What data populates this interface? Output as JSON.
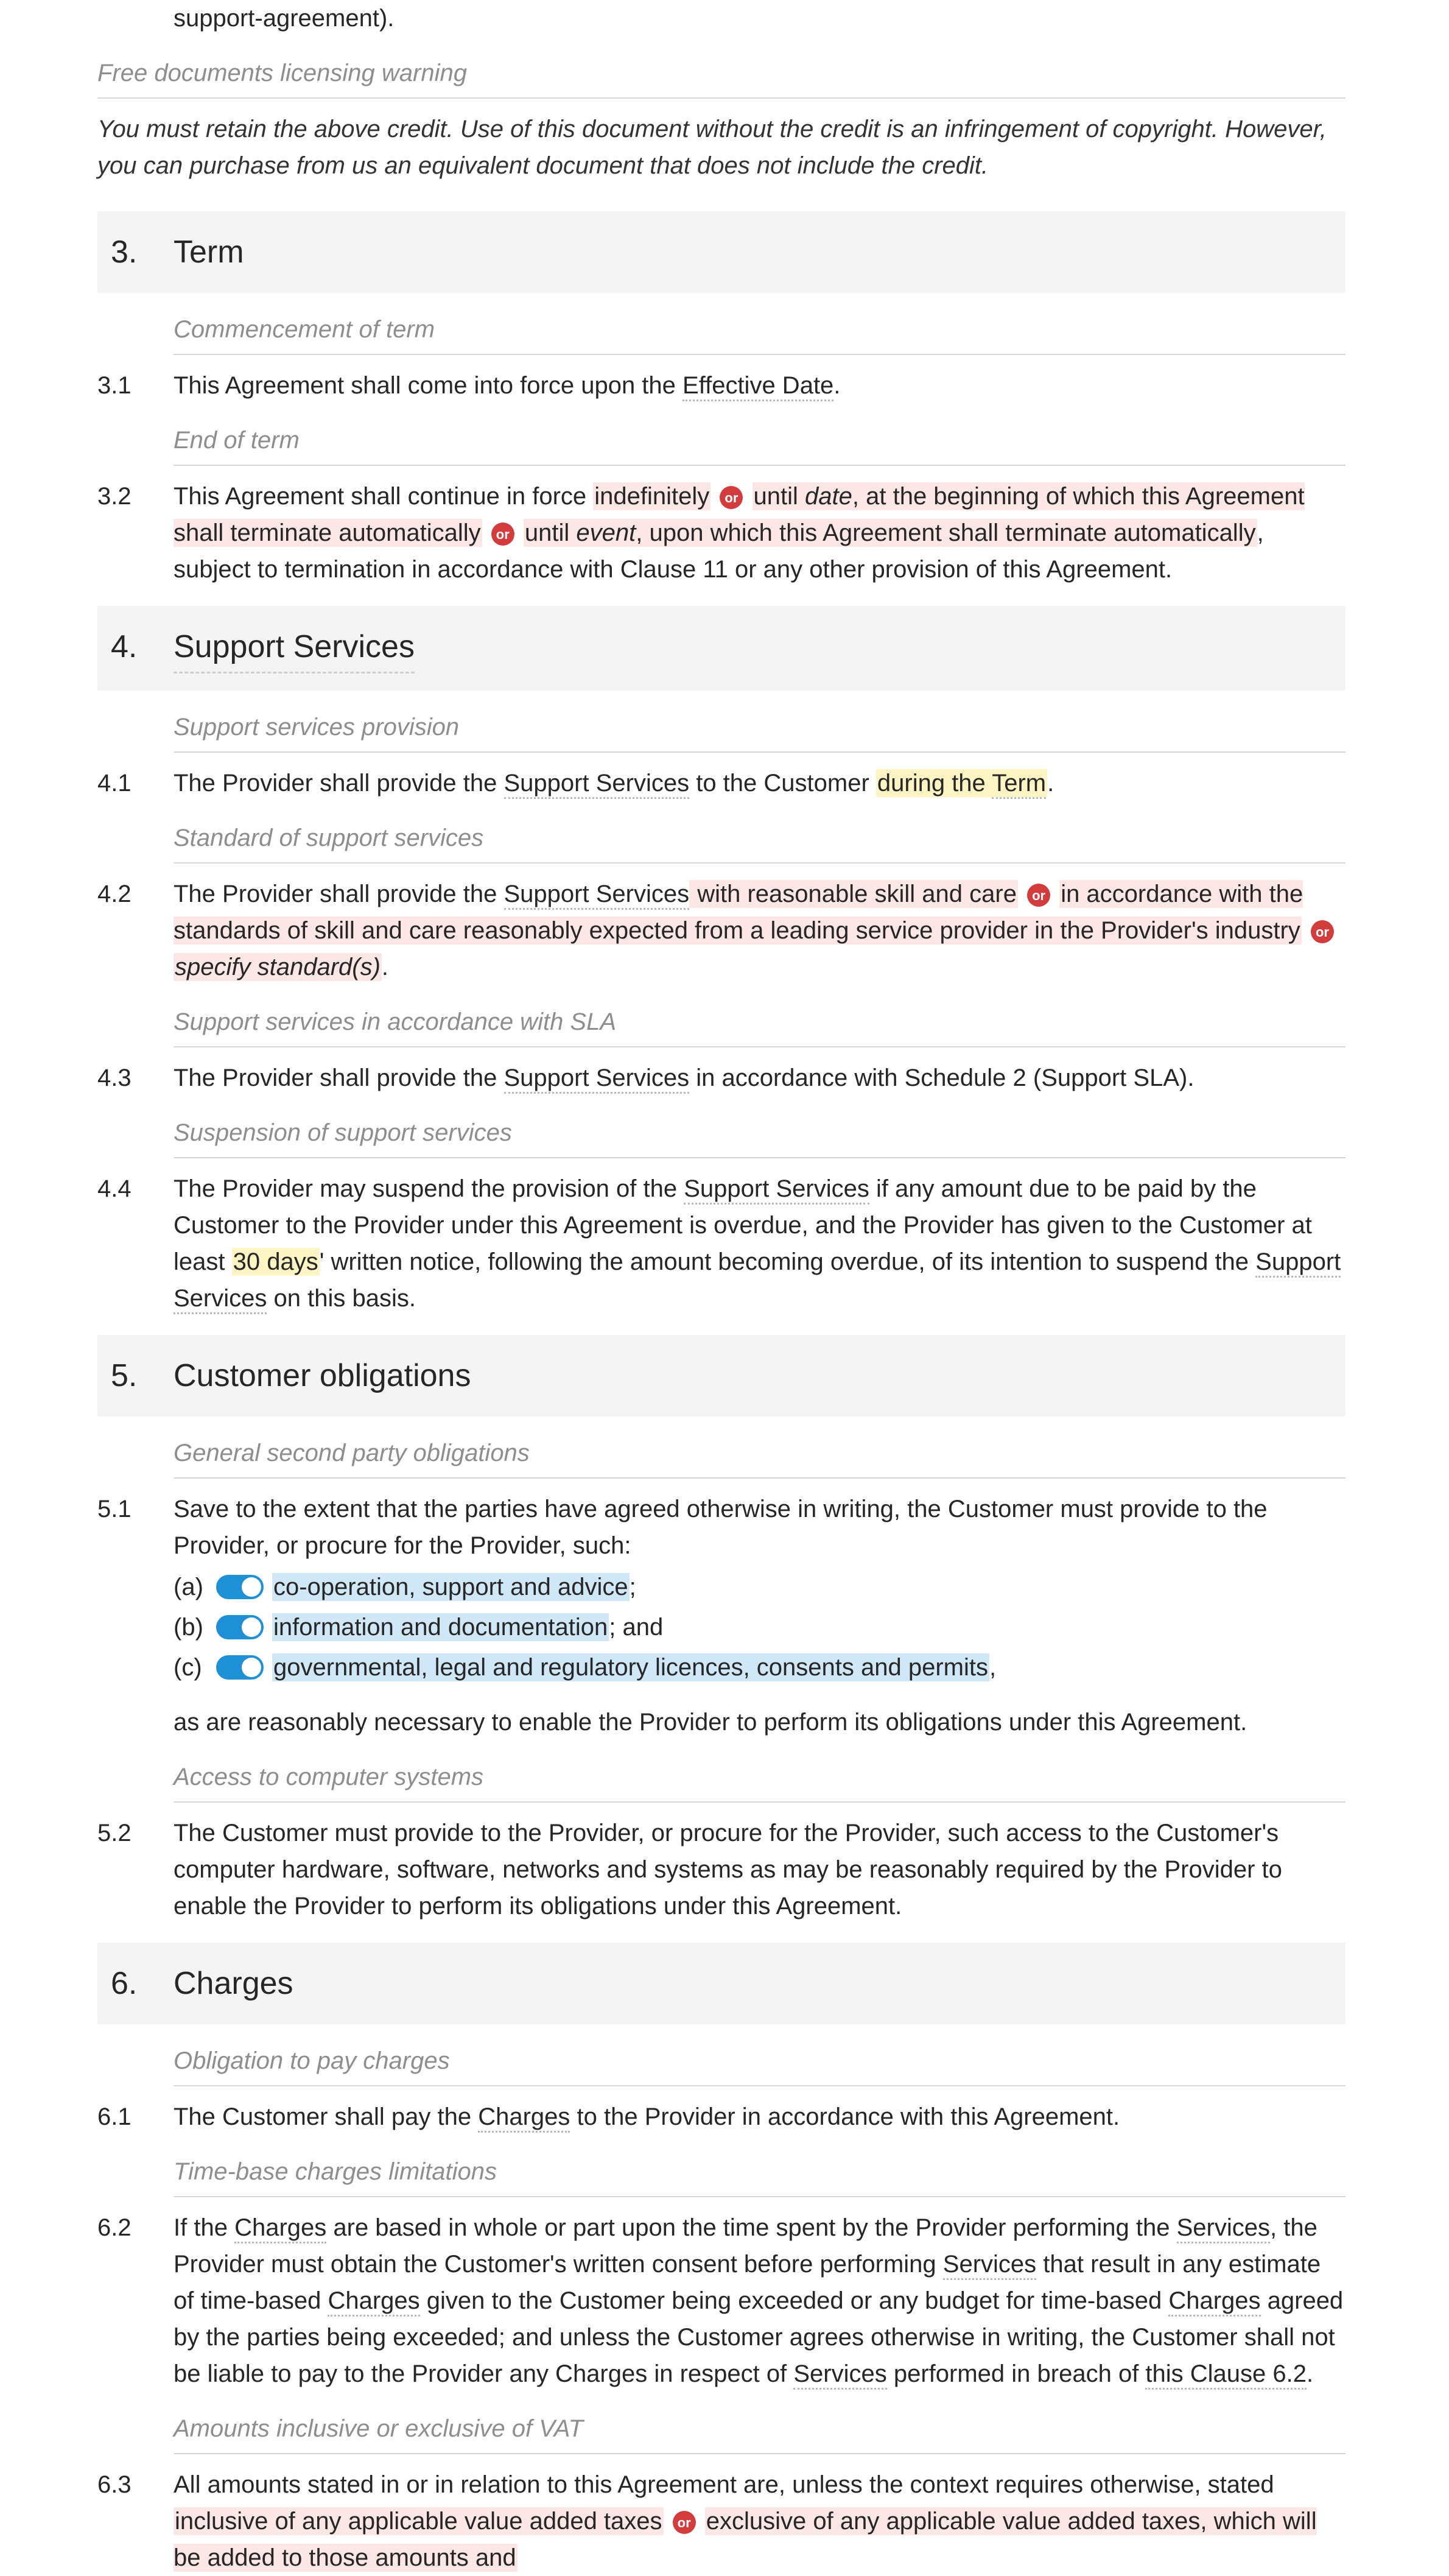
{
  "partial_top_line": "support-agreement).",
  "licensing_warning_label": "Free documents licensing warning",
  "licensing_warning_text": "You must retain the above credit. Use of this document without the credit is an infringement of copyright. However, you can purchase from us an equivalent document that does not include the credit.",
  "or_label": "or",
  "sections": {
    "s3": {
      "number": "3.",
      "title": "Term",
      "clauses": {
        "c1": {
          "annotation": "Commencement of term",
          "number": "3.1",
          "pre": "This Agreement shall come into force upon the ",
          "defined": "Effective Date",
          "post": "."
        },
        "c2": {
          "annotation": "End of term",
          "number": "3.2",
          "seg1": "This Agreement shall continue in force ",
          "opt1": "indefinitely",
          "opt2a": " until ",
          "opt2b": "date",
          "opt2c": ", at the beginning of which this Agreement shall terminate automatically",
          "opt3a": " until ",
          "opt3b": "event",
          "opt3c": ", upon which this Agreement shall terminate automatically",
          "seg2": ", subject to termination in accordance with Clause 11 or any other provision of this Agreement."
        }
      }
    },
    "s4": {
      "number": "4.",
      "title": "Support Services",
      "clauses": {
        "c1": {
          "annotation": "Support services provision",
          "number": "4.1",
          "a": "The Provider shall provide the ",
          "def1": "Support Services",
          "b": " to the Customer ",
          "hl": "during the ",
          "def2": "Term",
          "c": "."
        },
        "c2": {
          "annotation": "Standard of support services",
          "number": "4.2",
          "a": "The Provider shall provide the ",
          "def1": "Support Services",
          "opt1": " with reasonable skill and care",
          "opt2": " in accordance with the standards of skill and care reasonably expected from a leading service provider in the Provider's industry",
          "opt3": "specify standard(s)",
          "c": "."
        },
        "c3": {
          "annotation": "Support services in accordance with SLA",
          "number": "4.3",
          "a": "The Provider shall provide the ",
          "def1": "Support Services",
          "b": " in accordance with Schedule 2 (Support SLA)."
        },
        "c4": {
          "annotation": "Suspension of support services",
          "number": "4.4",
          "a": "The Provider may suspend the provision of the ",
          "def1": "Support Services",
          "b": " if any amount due to be paid by the Customer to the Provider under this Agreement is overdue, and the Provider has given to the Customer at least ",
          "hl": "30 days",
          "c": "' written notice, following the amount becoming overdue, of its intention to suspend the ",
          "def2": "Support Services",
          "d": " on this basis."
        }
      }
    },
    "s5": {
      "number": "5.",
      "title": "Customer obligations",
      "clauses": {
        "c1": {
          "annotation": "General second party obligations",
          "number": "5.1",
          "intro": "Save to the extent that the parties have agreed otherwise in writing, the Customer must provide to the Provider, or procure for the Provider, such:",
          "items": [
            {
              "letter": "(a)",
              "text": "co-operation, support and advice",
              "tail": ";"
            },
            {
              "letter": "(b)",
              "text": "information and documentation",
              "tail": "; and"
            },
            {
              "letter": "(c)",
              "text": "governmental, legal and regulatory licences, consents and permits",
              "tail": ","
            }
          ],
          "outro": "as are reasonably necessary to enable the Provider to perform its obligations under this Agreement."
        },
        "c2": {
          "annotation": "Access to computer systems",
          "number": "5.2",
          "text": "The Customer must provide to the Provider, or procure for the Provider, such access to the Customer's computer hardware, software, networks and systems as may be reasonably required by the Provider to enable the Provider to perform its obligations under this Agreement."
        }
      }
    },
    "s6": {
      "number": "6.",
      "title": "Charges",
      "clauses": {
        "c1": {
          "annotation": "Obligation to pay charges",
          "number": "6.1",
          "a": "The Customer shall pay the ",
          "def1": "Charges",
          "b": " to the Provider in accordance with this Agreement."
        },
        "c2": {
          "annotation": "Time-base charges limitations",
          "number": "6.2",
          "a": "If the ",
          "def1": "Charges",
          "b": " are based in whole or part upon the time spent by the Provider performing the ",
          "def2": "Services",
          "c": ", the Provider must obtain the Customer's written consent before performing ",
          "def3": "Services",
          "d": " that result in any estimate of time-based ",
          "def4": "Charges",
          "e": " given to the Customer being exceeded or any budget for time-based ",
          "def5": "Charges",
          "f": " agreed by the parties being exceeded; and unless the Customer agrees otherwise in writing, the Customer shall not be liable to pay to the Provider any Charges in respect of ",
          "def6": "Services",
          "g": " performed in breach of ",
          "def7": "this Clause 6.2",
          "h": "."
        },
        "c3": {
          "annotation": "Amounts inclusive or exclusive of VAT",
          "number": "6.3",
          "a": "All amounts stated in or in relation to this Agreement are, unless the context requires otherwise, stated ",
          "opt1": "inclusive of any applicable value added taxes",
          "opt2": " exclusive of any applicable value added taxes, which will be added to those amounts and"
        }
      }
    }
  }
}
